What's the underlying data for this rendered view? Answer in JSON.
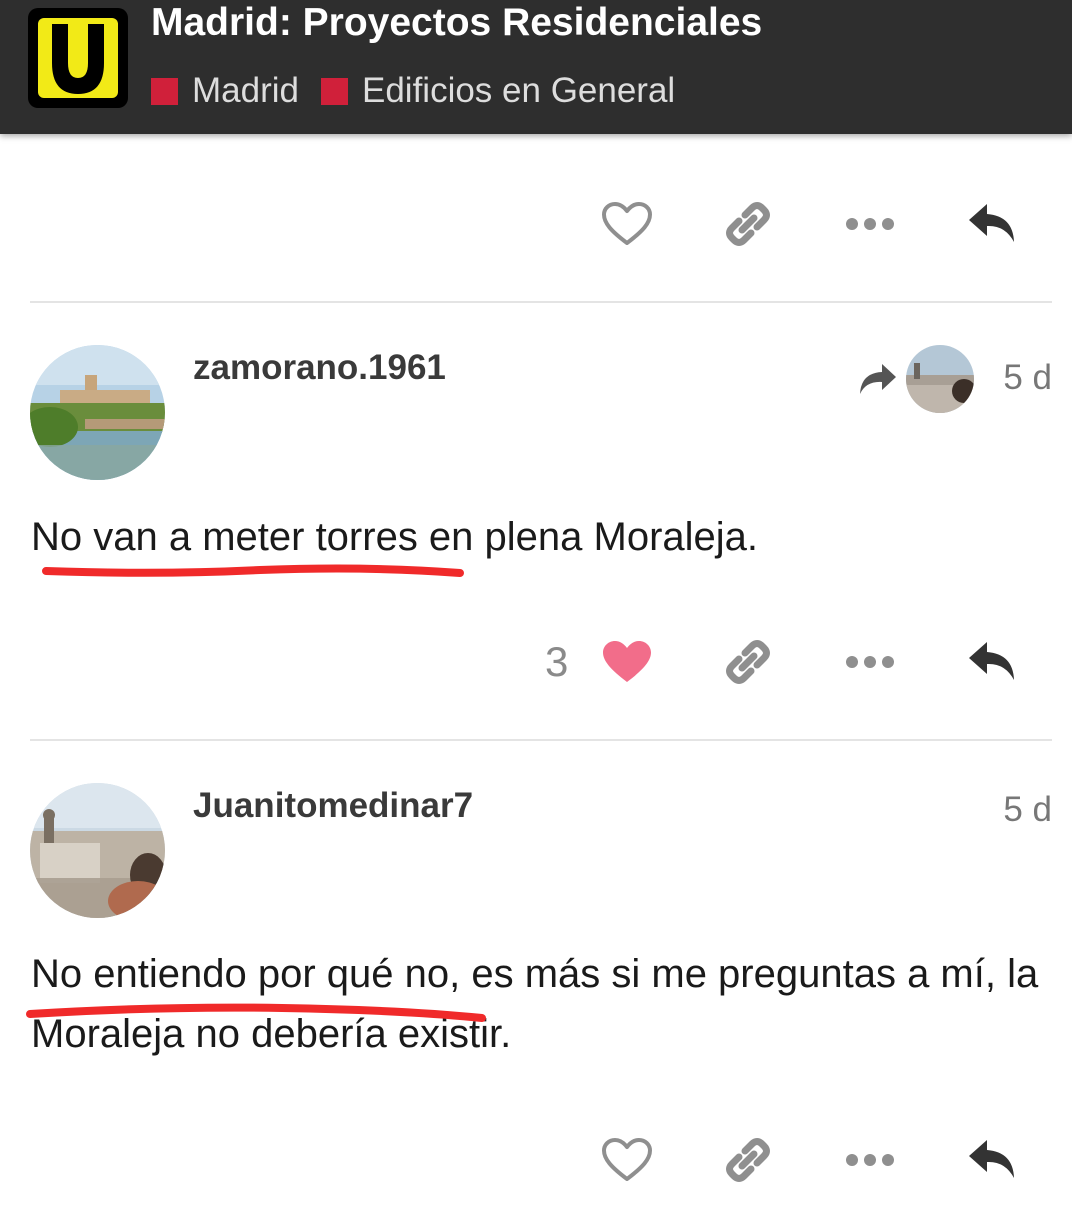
{
  "header": {
    "logo_letter": "U",
    "title": "Madrid: Proyectos Residenciales",
    "crumbs": [
      {
        "label": "Madrid",
        "color": "#d0203a"
      },
      {
        "label": "Edificios en General",
        "color": "#d0203a"
      }
    ]
  },
  "icons": {
    "like": "heart-outline-icon",
    "liked": "heart-filled-icon",
    "share": "link-icon",
    "more": "ellipsis-icon",
    "reply": "reply-icon",
    "reply_to": "reply-to-arrow-icon"
  },
  "posts": [
    {
      "username": "zamorano.1961",
      "age": "5 d",
      "text": "No van a meter torres en plena Moraleja.",
      "like_count": "3"
    },
    {
      "username": "Juanitomedinar7",
      "age": "5 d",
      "text": "No entiendo por qué no, es más si me preguntas a mí, la Moraleja no debería existir."
    }
  ],
  "colors": {
    "header_bg": "#2e2e2e",
    "logo_yellow": "#f2ea17",
    "liked_heart": "#f26d8a",
    "underline": "#f02a2a"
  }
}
